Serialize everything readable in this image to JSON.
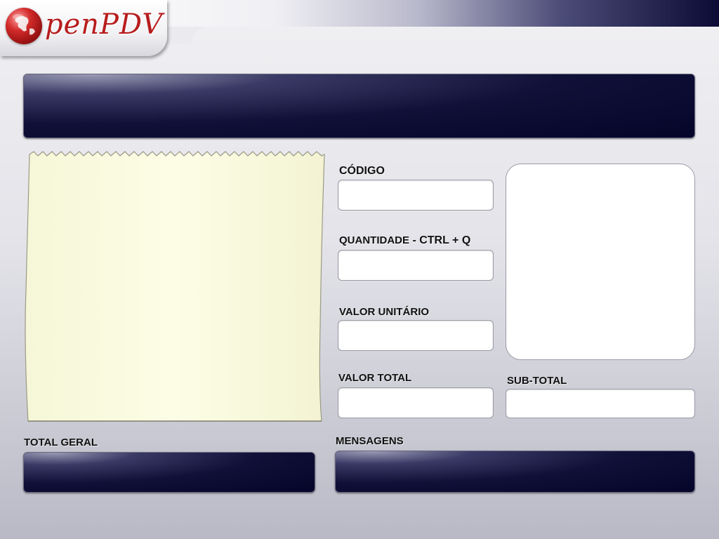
{
  "app": {
    "logo_text": "penPDV",
    "colors": {
      "accent_navy": "#0b0b35",
      "logo_red": "#b71c1c",
      "receipt_paper": "#fdfde4",
      "background": "#e3e3e9"
    },
    "icons": [
      "globe-logo-icon"
    ]
  },
  "fields": {
    "codigo_label": "CÓDIGO",
    "quantidade_label": "QUANTIDADE",
    "quantidade_hint": " - CTRL + Q",
    "valor_unitario_label": "VALOR UNITÁRIO",
    "valor_total_label": "VALOR TOTAL",
    "subtotal_label": "SUB-TOTAL",
    "total_geral_label": "TOTAL GERAL",
    "mensagens_label": "MENSAGENS"
  },
  "values": {
    "codigo": "",
    "quantidade": "",
    "valor_unitario": "",
    "valor_total": "",
    "subtotal": "",
    "total_geral": "",
    "mensagens": "",
    "header_display": ""
  }
}
